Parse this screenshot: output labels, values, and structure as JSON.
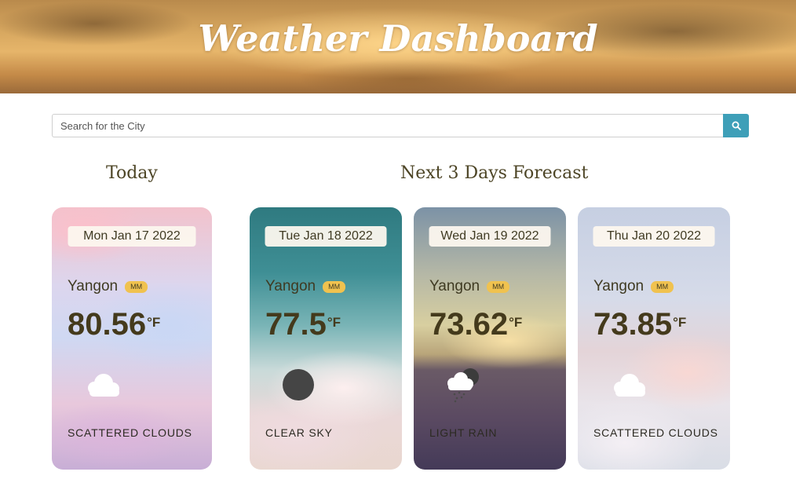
{
  "header": {
    "title": "Weather Dashboard"
  },
  "search": {
    "placeholder": "Search for the City",
    "button_icon": "search-icon"
  },
  "sections": {
    "today": "Today",
    "forecast": "Next 3 Days Forecast"
  },
  "unit": "°F",
  "colors": {
    "accent": "#3e9fb8",
    "badge": "#f0c24f",
    "text": "#443a1c"
  },
  "cards": [
    {
      "date": "Mon Jan 17 2022",
      "city": "Yangon",
      "country": "MM",
      "temp": "80.56",
      "unit": "°F",
      "icon": "cloud-icon",
      "description": "SCATTERED CLOUDS"
    },
    {
      "date": "Tue Jan 18 2022",
      "city": "Yangon",
      "country": "MM",
      "temp": "77.5",
      "unit": "°F",
      "icon": "moon-icon",
      "description": "CLEAR SKY"
    },
    {
      "date": "Wed Jan 19 2022",
      "city": "Yangon",
      "country": "MM",
      "temp": "73.62",
      "unit": "°F",
      "icon": "rain-cloud-moon-icon",
      "description": "LIGHT RAIN"
    },
    {
      "date": "Thu Jan 20 2022",
      "city": "Yangon",
      "country": "MM",
      "temp": "73.85",
      "unit": "°F",
      "icon": "cloud-icon",
      "description": "SCATTERED CLOUDS"
    }
  ]
}
